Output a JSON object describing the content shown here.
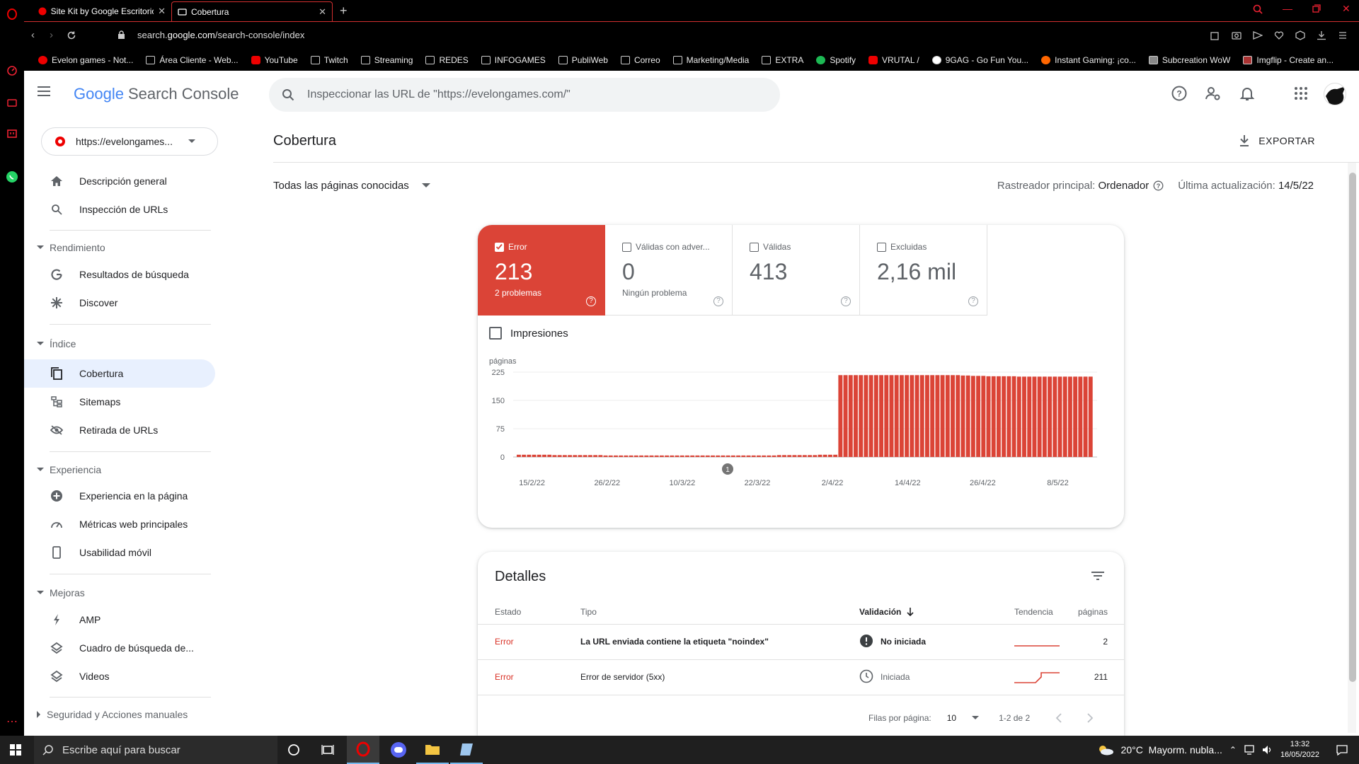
{
  "browser": {
    "tabs": [
      {
        "title": "Site Kit by Google Escritorio",
        "active": false
      },
      {
        "title": "Cobertura",
        "active": true
      }
    ],
    "url_prefix": "search.",
    "url_domain": "google.com",
    "url_path": "/search-console/index",
    "bookmarks": [
      {
        "label": "Evelon games - Not...",
        "icon": "red"
      },
      {
        "label": "Área Cliente - Web...",
        "icon": "box"
      },
      {
        "label": "YouTube",
        "icon": "red"
      },
      {
        "label": "Twitch",
        "icon": "box"
      },
      {
        "label": "Streaming",
        "icon": "box"
      },
      {
        "label": "REDES",
        "icon": "box"
      },
      {
        "label": "INFOGAMES",
        "icon": "box"
      },
      {
        "label": "PubliWeb",
        "icon": "box"
      },
      {
        "label": "Correo",
        "icon": "box"
      },
      {
        "label": "Marketing/Media",
        "icon": "box"
      },
      {
        "label": "EXTRA",
        "icon": "box"
      },
      {
        "label": "Spotify",
        "icon": "green"
      },
      {
        "label": "VRUTAL /",
        "icon": "red"
      },
      {
        "label": "9GAG - Go Fun You...",
        "icon": "box"
      },
      {
        "label": "Instant Gaming: ¡co...",
        "icon": "red"
      },
      {
        "label": "Subcreation WoW",
        "icon": "box"
      },
      {
        "label": "Imgflip - Create an...",
        "icon": "box"
      }
    ]
  },
  "header": {
    "logo_google": "Google",
    "logo_product": "Search Console",
    "search_placeholder": "Inspeccionar las URL de \"https://evelongames.com/\""
  },
  "nav": {
    "property": "https://evelongames...",
    "items": {
      "overview": "Descripción general",
      "url_inspection": "Inspección de URLs",
      "sec_performance": "Rendimiento",
      "search_results": "Resultados de búsqueda",
      "discover": "Discover",
      "sec_index": "Índice",
      "coverage": "Cobertura",
      "sitemaps": "Sitemaps",
      "removals": "Retirada de URLs",
      "sec_experience": "Experiencia",
      "page_experience": "Experiencia en la página",
      "web_vitals": "Métricas web principales",
      "mobile_usability": "Usabilidad móvil",
      "sec_enhancements": "Mejoras",
      "amp": "AMP",
      "sitelinks_search": "Cuadro de búsqueda de...",
      "videos": "Videos",
      "sec_security": "Seguridad y Acciones manuales"
    }
  },
  "main": {
    "title": "Cobertura",
    "export_label": "EXPORTAR",
    "filter_label": "Todas las páginas conocidas",
    "crawler_label": "Rastreador principal:",
    "crawler_value": "Ordenador",
    "updated_label": "Última actualización:",
    "updated_value": "14/5/22",
    "stats": {
      "error": {
        "label": "Error",
        "value": "213",
        "sub": "2 problemas",
        "checked": true
      },
      "warnings": {
        "label": "Válidas con adver...",
        "value": "0",
        "sub": "Ningún problema",
        "checked": false
      },
      "valid": {
        "label": "Válidas",
        "value": "413",
        "sub": "",
        "checked": false
      },
      "excluded": {
        "label": "Excluidas",
        "value": "2,16 mil",
        "sub": "",
        "checked": false
      }
    },
    "impressions_label": "Impresiones",
    "annotation_marker": "1"
  },
  "chart_data": {
    "type": "bar",
    "ylabel": "páginas",
    "ylim": [
      0,
      225
    ],
    "yticks": [
      0,
      75,
      150,
      225
    ],
    "xtick_labels": [
      "15/2/22",
      "26/2/22",
      "10/3/22",
      "22/3/22",
      "2/4/22",
      "14/4/22",
      "26/4/22",
      "8/5/22"
    ],
    "series": [
      {
        "color": "#db4437",
        "values": [
          6,
          6,
          6,
          6,
          6,
          6,
          6,
          5,
          5,
          5,
          5,
          5,
          5,
          5,
          5,
          5,
          5,
          4,
          4,
          4,
          4,
          4,
          4,
          4,
          4,
          4,
          4,
          4,
          4,
          4,
          4,
          4,
          4,
          4,
          4,
          4,
          4,
          4,
          4,
          4,
          4,
          4,
          4,
          4,
          4,
          4,
          4,
          4,
          4,
          4,
          4,
          5,
          5,
          5,
          5,
          5,
          5,
          5,
          5,
          6,
          6,
          6,
          6,
          217,
          217,
          217,
          217,
          217,
          217,
          217,
          217,
          217,
          217,
          217,
          217,
          217,
          217,
          217,
          217,
          217,
          217,
          217,
          217,
          217,
          217,
          217,
          217,
          216,
          216,
          215,
          215,
          215,
          214,
          214,
          214,
          214,
          214,
          214,
          213,
          213,
          213,
          213,
          213,
          213,
          213,
          213,
          213,
          213,
          213,
          213,
          213,
          213,
          213
        ]
      }
    ]
  },
  "details": {
    "title": "Detalles",
    "columns": {
      "status": "Estado",
      "type": "Tipo",
      "validation": "Validación",
      "trend": "Tendencia",
      "pages": "páginas"
    },
    "rows": [
      {
        "status": "Error",
        "type": "La URL enviada contiene la etiqueta \"noindex\"",
        "validation": "No iniciada",
        "pages": "2"
      },
      {
        "status": "Error",
        "type": "Error de servidor (5xx)",
        "validation": "Iniciada",
        "pages": "211"
      }
    ],
    "rows_per_page_label": "Filas por página:",
    "rows_per_page": "10",
    "range": "1-2 de 2"
  },
  "taskbar": {
    "search_placeholder": "Escribe aquí para buscar",
    "weather": "20°C  Mayorm. nubla...",
    "time": "13:32",
    "date": "16/05/2022"
  }
}
